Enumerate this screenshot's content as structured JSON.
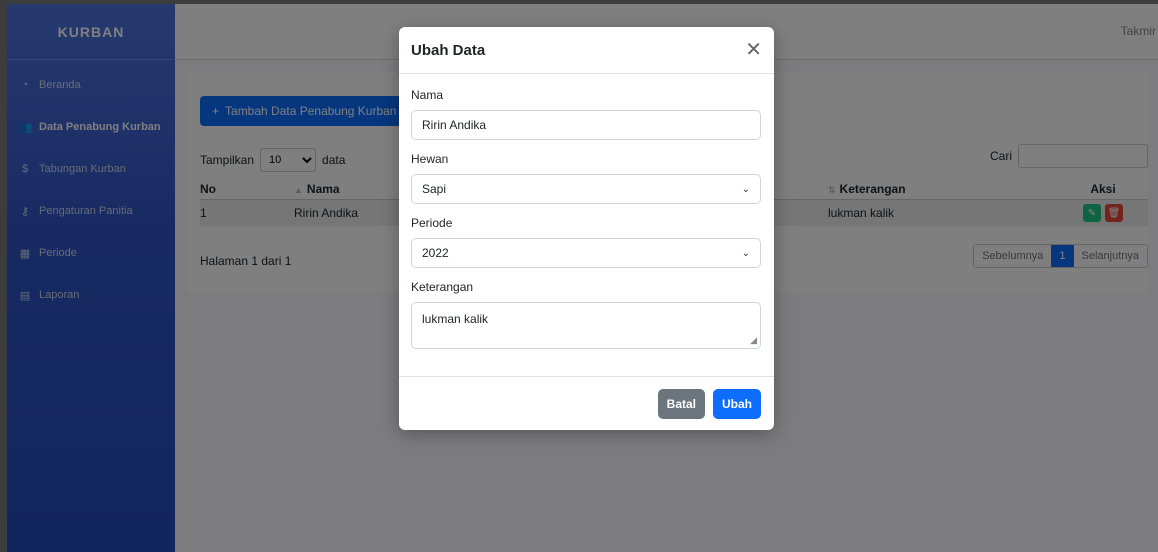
{
  "sidebar": {
    "brand": "KURBAN",
    "items": [
      {
        "label": "Beranda",
        "icon": "gauge-icon"
      },
      {
        "label": "Data Penabung Kurban",
        "icon": "users-icon"
      },
      {
        "label": "Tabungan Kurban",
        "icon": "dollar-icon"
      },
      {
        "label": "Pengaturan Panitia",
        "icon": "key-icon"
      },
      {
        "label": "Periode",
        "icon": "calendar-icon"
      },
      {
        "label": "Laporan",
        "icon": "table-icon"
      }
    ]
  },
  "topbar": {
    "user": "Takmir"
  },
  "page": {
    "add_button": "Tambah Data Penabung Kurban",
    "show_label": "Tampilkan",
    "show_value": "10",
    "show_suffix": "data",
    "search_label": "Cari",
    "table": {
      "headers": [
        "No",
        "Nama",
        "Keterangan",
        "Aksi"
      ],
      "rows": [
        {
          "no": "1",
          "nama": "Ririn Andika",
          "keterangan": "lukman kalik"
        }
      ]
    },
    "info": "Halaman 1 dari 1",
    "pager": {
      "prev": "Sebelumnya",
      "current": "1",
      "next": "Selanjutnya"
    }
  },
  "modal": {
    "title": "Ubah Data",
    "nama_label": "Nama",
    "nama_value": "Ririn Andika",
    "hewan_label": "Hewan",
    "hewan_value": "Sapi",
    "periode_label": "Periode",
    "periode_value": "2022",
    "keterangan_label": "Keterangan",
    "keterangan_value": "lukman kalik",
    "cancel": "Batal",
    "submit": "Ubah"
  }
}
